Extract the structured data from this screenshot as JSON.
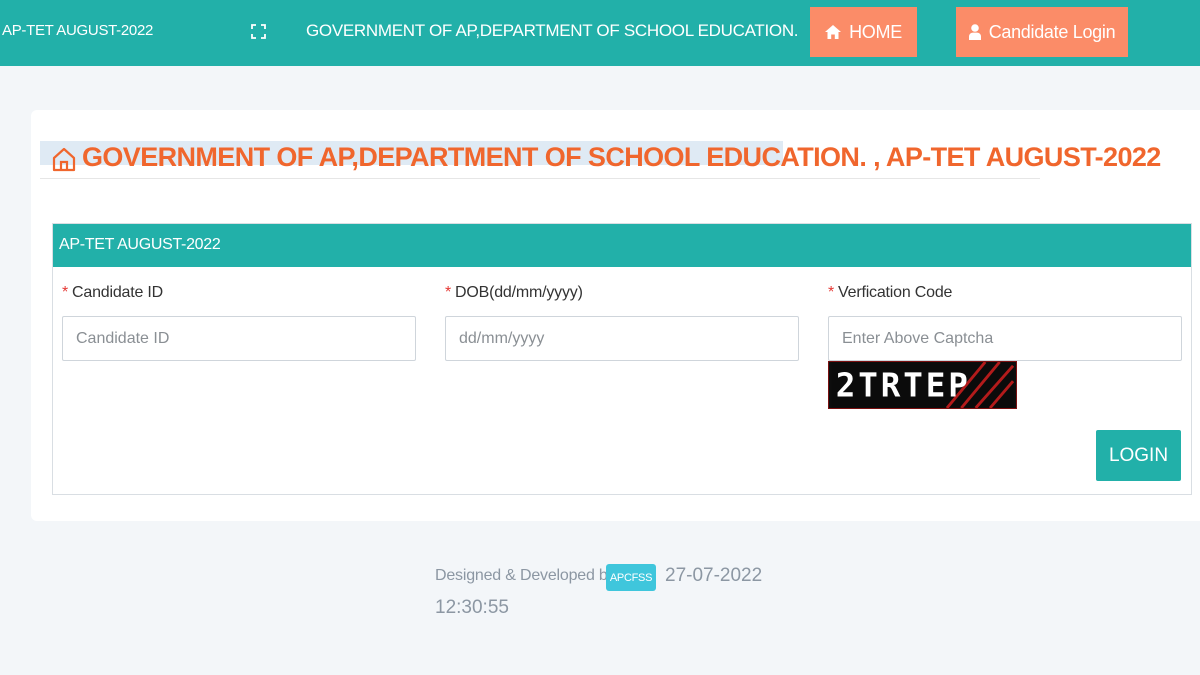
{
  "header": {
    "brand": "AP-TET AUGUST-2022",
    "title": "GOVERNMENT OF AP,DEPARTMENT OF SCHOOL EDUCATION.",
    "nav": {
      "home_label": "HOME",
      "login_label": "Candidate Login"
    },
    "icons": [
      "expand-icon",
      "home-icon",
      "user-icon"
    ]
  },
  "page": {
    "heading": "GOVERNMENT OF AP,DEPARTMENT OF SCHOOL EDUCATION. , AP-TET AUGUST-2022"
  },
  "form": {
    "panel_title": "AP-TET AUGUST-2022",
    "required_marker": "*",
    "fields": [
      {
        "label": "Candidate ID",
        "placeholder": "Candidate ID",
        "value": ""
      },
      {
        "label": "DOB(dd/mm/yyyy)",
        "placeholder": "dd/mm/yyyy",
        "value": ""
      },
      {
        "label": "Verfication Code",
        "placeholder": "Enter Above Captcha",
        "value": ""
      }
    ],
    "captcha_text": "2TRTEP",
    "submit_label": "LOGIN"
  },
  "footer": {
    "designed_by": "Designed & Developed by",
    "badge": "APCFSS",
    "date": "27-07-2022",
    "time": "12:30:55"
  },
  "colors": {
    "primary": "#22b0a9",
    "accent": "#fb8c68",
    "heading": "#f0662d",
    "required": "#e53935",
    "badge": "#3fc6dc",
    "background": "#f3f6f9"
  }
}
